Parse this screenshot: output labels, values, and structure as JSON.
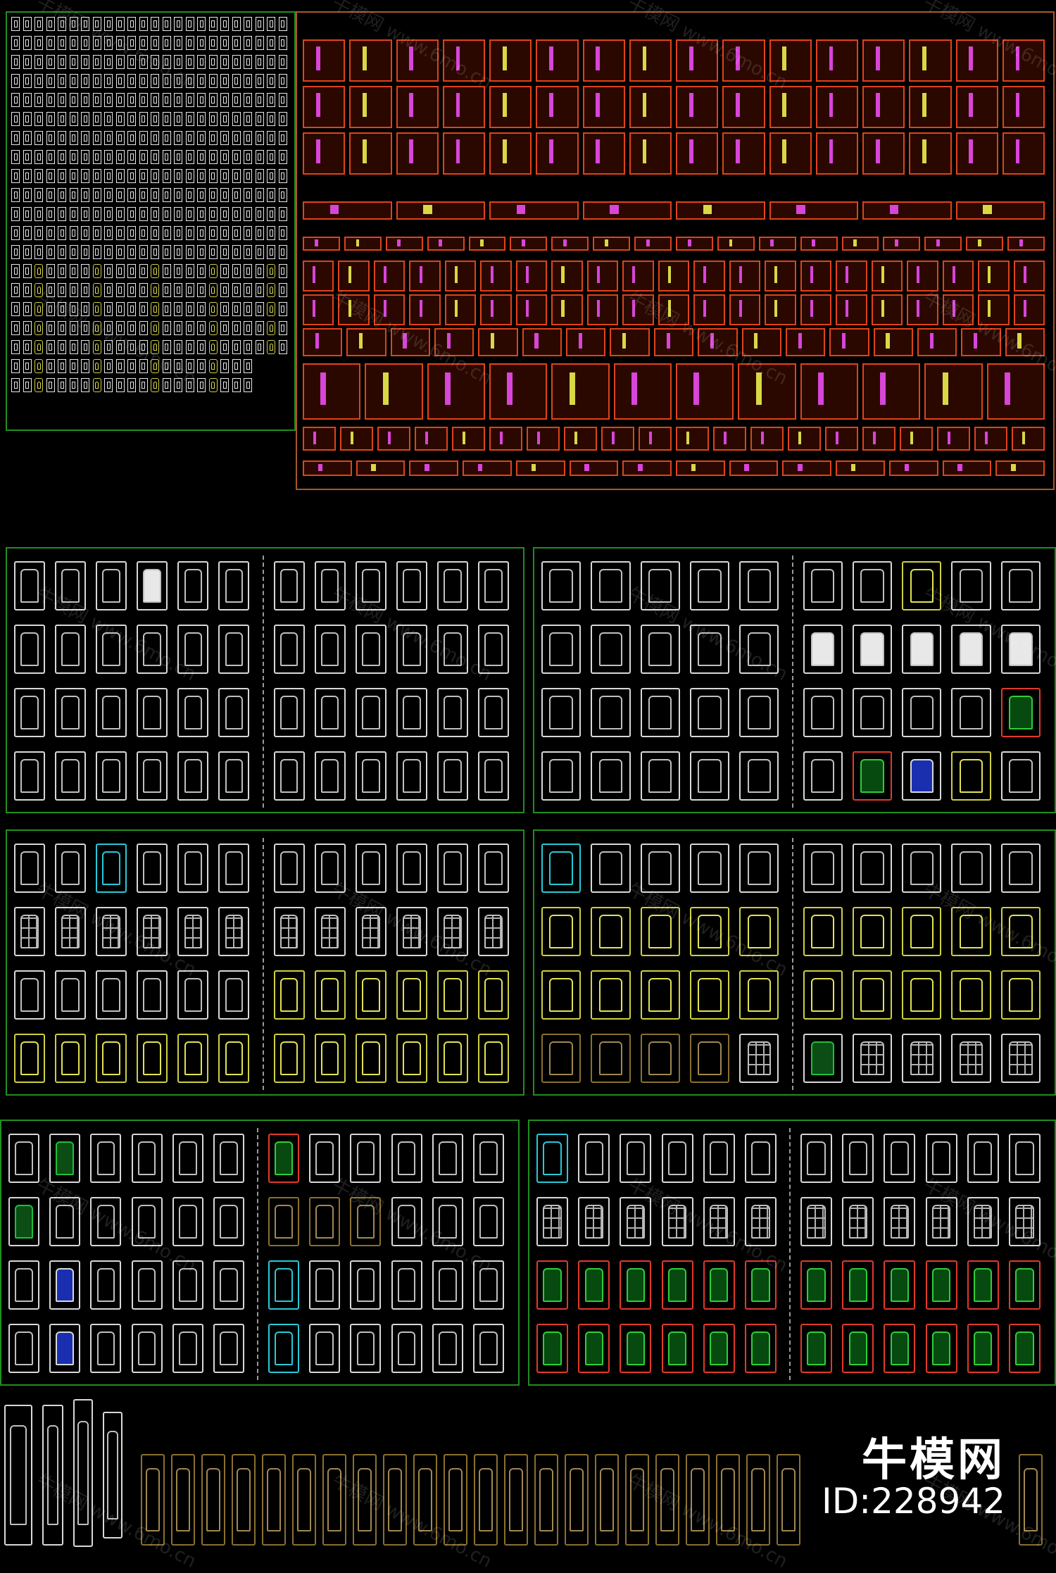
{
  "watermark": {
    "text_a": "牛模网",
    "text_b": "www.6mo.cn"
  },
  "logo": {
    "name": "牛模网",
    "id": "ID:228942"
  },
  "colors": {
    "background": "#000000",
    "frame_green": "#1f8f1f",
    "frame_orange": "#a8582a",
    "cad_white": "#d8d8d8",
    "cad_yellow": "#cfcf44",
    "cad_cyan": "#28c9d8",
    "cad_red": "#e23a2a",
    "cad_magenta": "#d845d8"
  }
}
